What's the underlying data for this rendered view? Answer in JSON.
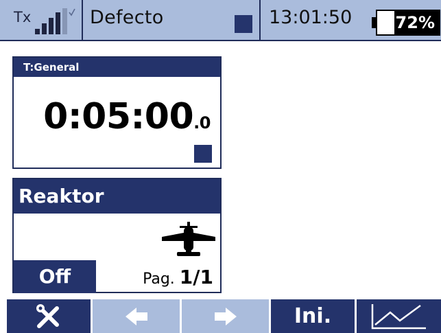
{
  "status_bar": {
    "tx_label": "Tx",
    "model_name": "Defecto",
    "clock": "13:01:50",
    "battery_percent_label": "72%",
    "battery_level": 0.72,
    "signal_bars": 4,
    "signal_icon": "signal-bars-icon",
    "flight_mode_color": "#25346c"
  },
  "timer_widget": {
    "title": "T:General",
    "time_main": "0:05:00",
    "time_tenths": ".0"
  },
  "model_widget": {
    "title": "Reaktor",
    "state": "Off",
    "page_prefix": "Pag.",
    "page_number": "1/1",
    "icon": "airplane-icon"
  },
  "toolbar": {
    "buttons": [
      {
        "name": "tools",
        "icon": "wrench-screwdriver-icon",
        "enabled": true
      },
      {
        "name": "prev-page",
        "icon": "arrow-left-icon",
        "enabled": false
      },
      {
        "name": "next-page",
        "icon": "arrow-right-icon",
        "enabled": false
      },
      {
        "name": "ini",
        "label": "Ini.",
        "enabled": true
      },
      {
        "name": "telemetry",
        "icon": "chart-line-icon",
        "enabled": true
      }
    ]
  },
  "colors": {
    "dark_blue": "#24336b",
    "light_blue": "#aabcdc",
    "border": "#1f2c59"
  }
}
